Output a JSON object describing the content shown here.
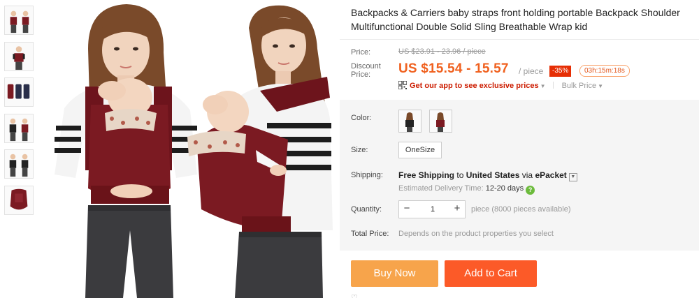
{
  "product": {
    "title": "Backpacks & Carriers baby straps front holding portable Backpack Shoulder Multifunctional Double Solid Sling Breathable Wrap kid"
  },
  "gallery": {
    "thumbnails": [
      "thumb-1",
      "thumb-2",
      "thumb-3",
      "thumb-4",
      "thumb-5",
      "thumb-6"
    ],
    "main_image_icon": "baby-carrier-photo"
  },
  "price": {
    "price_label": "Price:",
    "original": "US $23.91 - 23.96 / piece",
    "discount_label": "Discount Price:",
    "discount_label_line1": "Discount",
    "discount_label_line2": "Price:",
    "current": "US $15.54 - 15.57",
    "unit": "/ piece",
    "discount_badge": "-35%",
    "countdown": "03h:15m:18s",
    "app_promo": "Get our app to see exclusive prices",
    "bulk_price": "Bulk Price"
  },
  "sku": {
    "color_label": "Color:",
    "size_label": "Size:",
    "size_value": "OneSize",
    "shipping_label": "Shipping:",
    "shipping_free": "Free Shipping",
    "shipping_to": "to",
    "shipping_country": "United States",
    "shipping_via": "via",
    "shipping_method": "ePacket",
    "delivery_label": "Estimated Delivery Time:",
    "delivery_value": "12-20 days",
    "quantity_label": "Quantity:",
    "quantity_value": "1",
    "quantity_minus": "−",
    "quantity_plus": "+",
    "quantity_note": "piece (8000 pieces available)",
    "total_label": "Total Price:",
    "total_text": "Depends on the product properties you select"
  },
  "actions": {
    "buy_now": "Buy Now",
    "add_to_cart": "Add to Cart"
  },
  "colors": {
    "price_orange": "#f0611f",
    "discount_red": "#e62e04",
    "buy_now": "#f7a44b",
    "add_to_cart": "#fc5a28",
    "carrier_burgundy": "#7b1a22"
  }
}
